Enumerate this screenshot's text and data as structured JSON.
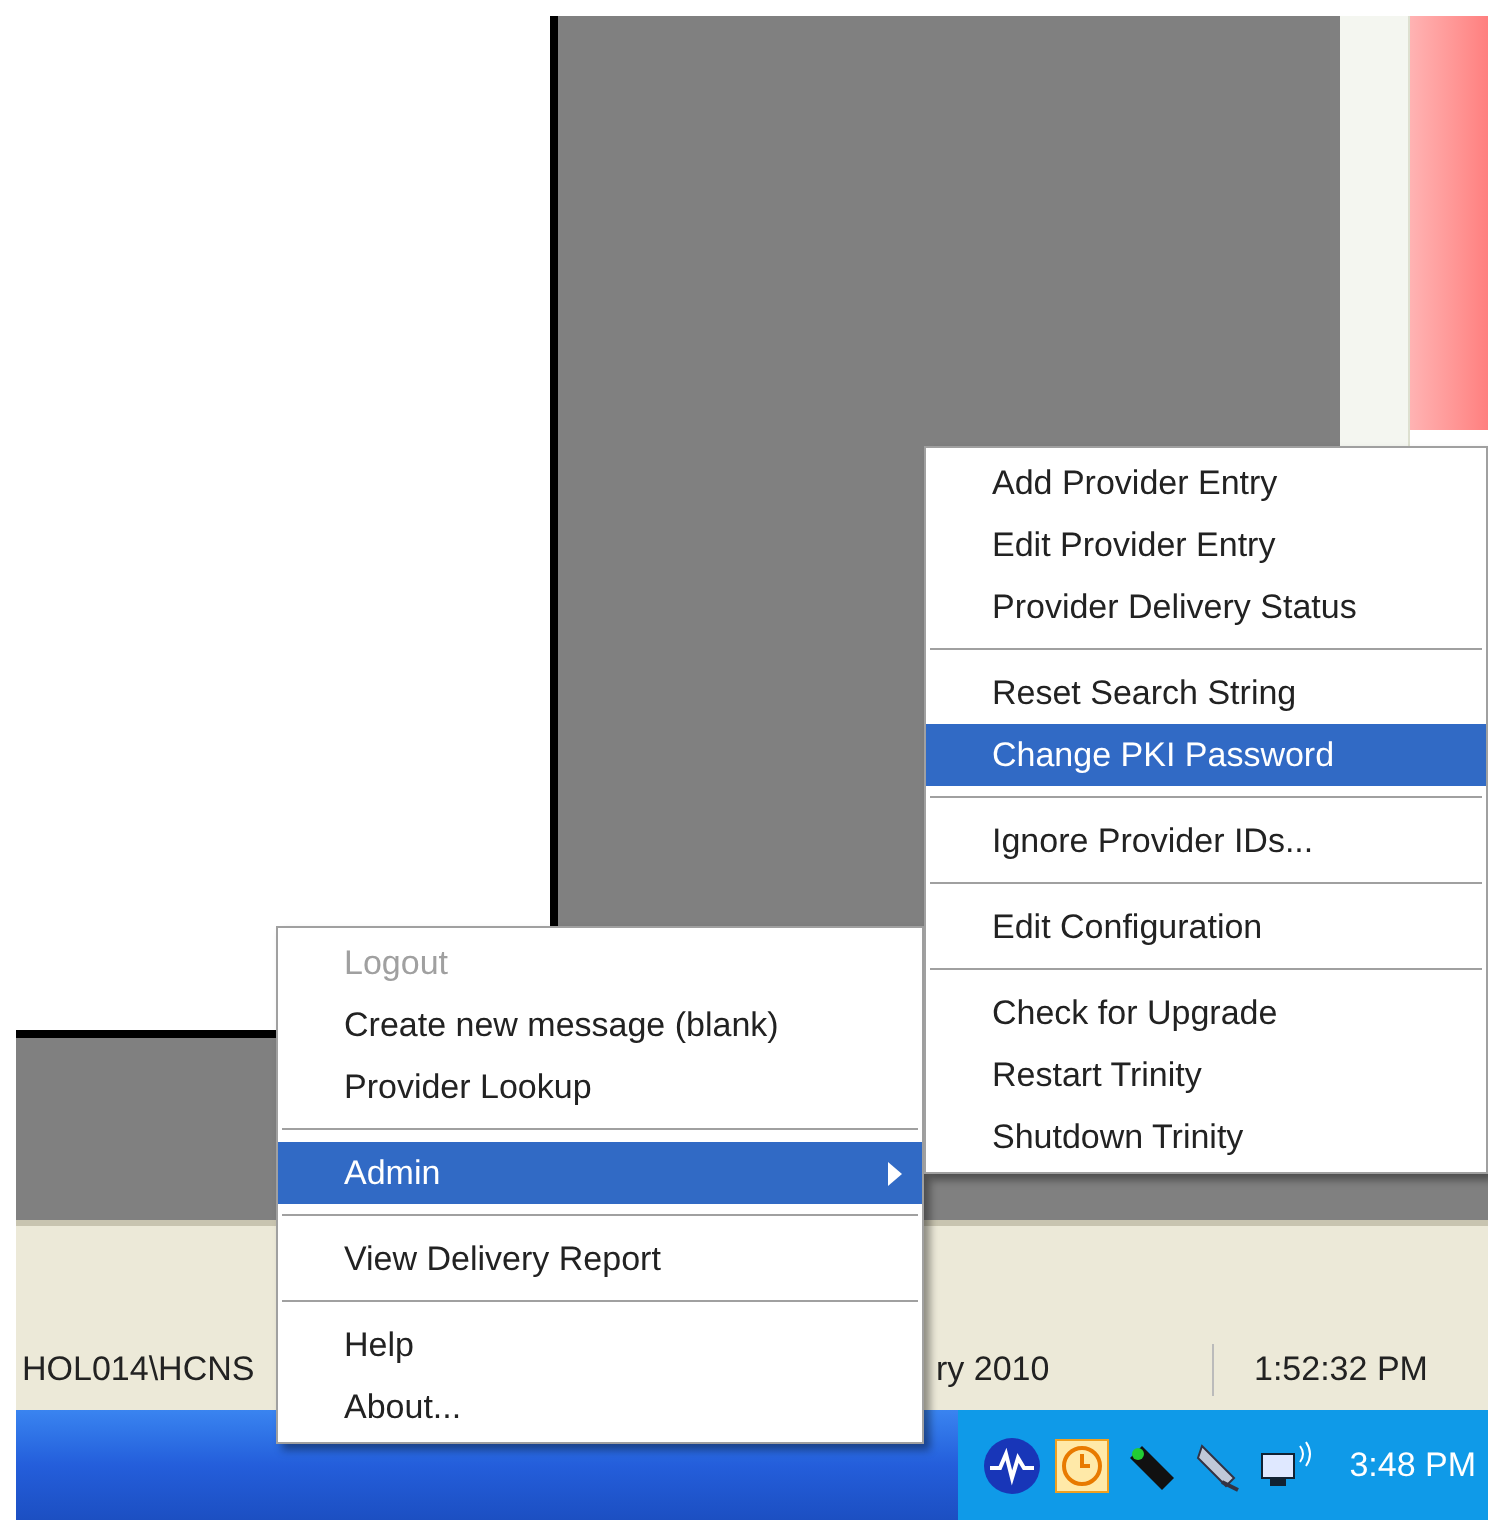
{
  "status_bar": {
    "cells": [
      "HOL014\\HCNS",
      "ry 2010",
      "1:52:32 PM"
    ]
  },
  "taskbar": {
    "clock": "3:48 PM"
  },
  "context_menu": {
    "items": [
      {
        "kind": "item",
        "label": "Logout",
        "disabled": true,
        "selected": false
      },
      {
        "kind": "item",
        "label": "Create new message (blank)",
        "disabled": false,
        "selected": false
      },
      {
        "kind": "item",
        "label": "Provider Lookup",
        "disabled": false,
        "selected": false
      },
      {
        "kind": "separator"
      },
      {
        "kind": "submenu",
        "label": "Admin",
        "disabled": false,
        "selected": true
      },
      {
        "kind": "separator"
      },
      {
        "kind": "item",
        "label": "View Delivery Report",
        "disabled": false,
        "selected": false
      },
      {
        "kind": "separator"
      },
      {
        "kind": "item",
        "label": "Help",
        "disabled": false,
        "selected": false
      },
      {
        "kind": "item",
        "label": "About...",
        "disabled": false,
        "selected": false
      }
    ]
  },
  "admin_submenu": {
    "items": [
      {
        "kind": "item",
        "label": "Add Provider Entry",
        "selected": false
      },
      {
        "kind": "item",
        "label": "Edit Provider Entry",
        "selected": false
      },
      {
        "kind": "item",
        "label": "Provider Delivery Status",
        "selected": false
      },
      {
        "kind": "separator"
      },
      {
        "kind": "item",
        "label": "Reset Search String",
        "selected": false
      },
      {
        "kind": "item",
        "label": "Change PKI Password",
        "selected": true
      },
      {
        "kind": "separator"
      },
      {
        "kind": "item",
        "label": "Ignore Provider IDs...",
        "selected": false
      },
      {
        "kind": "separator"
      },
      {
        "kind": "item",
        "label": "Edit Configuration",
        "selected": false
      },
      {
        "kind": "separator"
      },
      {
        "kind": "item",
        "label": "Check for Upgrade",
        "selected": false
      },
      {
        "kind": "item",
        "label": "Restart Trinity",
        "selected": false
      },
      {
        "kind": "item",
        "label": "Shutdown Trinity",
        "selected": false
      }
    ]
  }
}
